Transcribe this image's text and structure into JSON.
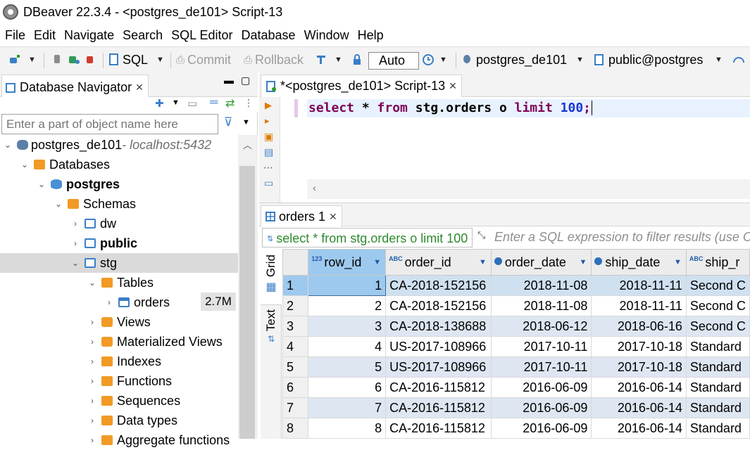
{
  "window": {
    "title": "DBeaver 22.3.4 - <postgres_de101> Script-13"
  },
  "menu": [
    "File",
    "Edit",
    "Navigate",
    "Search",
    "SQL Editor",
    "Database",
    "Window",
    "Help"
  ],
  "toolbar": {
    "sql_label": "SQL",
    "commit_label": "Commit",
    "rollback_label": "Rollback",
    "auto_label": "Auto",
    "connection": "postgres_de101",
    "schema": "public@postgres"
  },
  "navigator": {
    "tab_title": "Database Navigator",
    "filter_placeholder": "Enter a part of object name here",
    "tree": [
      {
        "label": "postgres_de101",
        "suffix": " - localhost:5432"
      },
      {
        "label": "Databases"
      },
      {
        "label": "postgres"
      },
      {
        "label": "Schemas"
      },
      {
        "label": "dw"
      },
      {
        "label": "public"
      },
      {
        "label": "stg"
      },
      {
        "label": "Tables"
      },
      {
        "label": "orders",
        "badge": "2.7M"
      },
      {
        "label": "Views"
      },
      {
        "label": "Materialized Views"
      },
      {
        "label": "Indexes"
      },
      {
        "label": "Functions"
      },
      {
        "label": "Sequences"
      },
      {
        "label": "Data types"
      },
      {
        "label": "Aggregate functions"
      }
    ]
  },
  "editor": {
    "tab_title": "*<postgres_de101> Script-13",
    "sql": {
      "k1": "select",
      "star": " * ",
      "k2": "from",
      "ident": " stg.orders o ",
      "k3": "limit",
      "num": " 100",
      "end": ";"
    }
  },
  "results": {
    "tab_title": "orders 1",
    "query": "select * from stg.orders o limit 100",
    "filter_placeholder": "Enter a SQL expression to filter results (use Ctrl",
    "side_tabs": [
      "Grid",
      "Text"
    ],
    "columns": [
      {
        "type": "123",
        "name": "row_id"
      },
      {
        "type": "ABC",
        "name": "order_id"
      },
      {
        "type": "clock",
        "name": "order_date"
      },
      {
        "type": "clock",
        "name": "ship_date"
      },
      {
        "type": "ABC",
        "name": "ship_r"
      }
    ],
    "rows": [
      {
        "n": "1",
        "row_id": "1",
        "order_id": "CA-2018-152156",
        "order_date": "2018-11-08",
        "ship_date": "2018-11-11",
        "ship_mode": "Second C"
      },
      {
        "n": "2",
        "row_id": "2",
        "order_id": "CA-2018-152156",
        "order_date": "2018-11-08",
        "ship_date": "2018-11-11",
        "ship_mode": "Second C"
      },
      {
        "n": "3",
        "row_id": "3",
        "order_id": "CA-2018-138688",
        "order_date": "2018-06-12",
        "ship_date": "2018-06-16",
        "ship_mode": "Second C"
      },
      {
        "n": "4",
        "row_id": "4",
        "order_id": "US-2017-108966",
        "order_date": "2017-10-11",
        "ship_date": "2017-10-18",
        "ship_mode": "Standard"
      },
      {
        "n": "5",
        "row_id": "5",
        "order_id": "US-2017-108966",
        "order_date": "2017-10-11",
        "ship_date": "2017-10-18",
        "ship_mode": "Standard"
      },
      {
        "n": "6",
        "row_id": "6",
        "order_id": "CA-2016-115812",
        "order_date": "2016-06-09",
        "ship_date": "2016-06-14",
        "ship_mode": "Standard"
      },
      {
        "n": "7",
        "row_id": "7",
        "order_id": "CA-2016-115812",
        "order_date": "2016-06-09",
        "ship_date": "2016-06-14",
        "ship_mode": "Standard"
      },
      {
        "n": "8",
        "row_id": "8",
        "order_id": "CA-2016-115812",
        "order_date": "2016-06-09",
        "ship_date": "2016-06-14",
        "ship_mode": "Standard"
      }
    ]
  }
}
